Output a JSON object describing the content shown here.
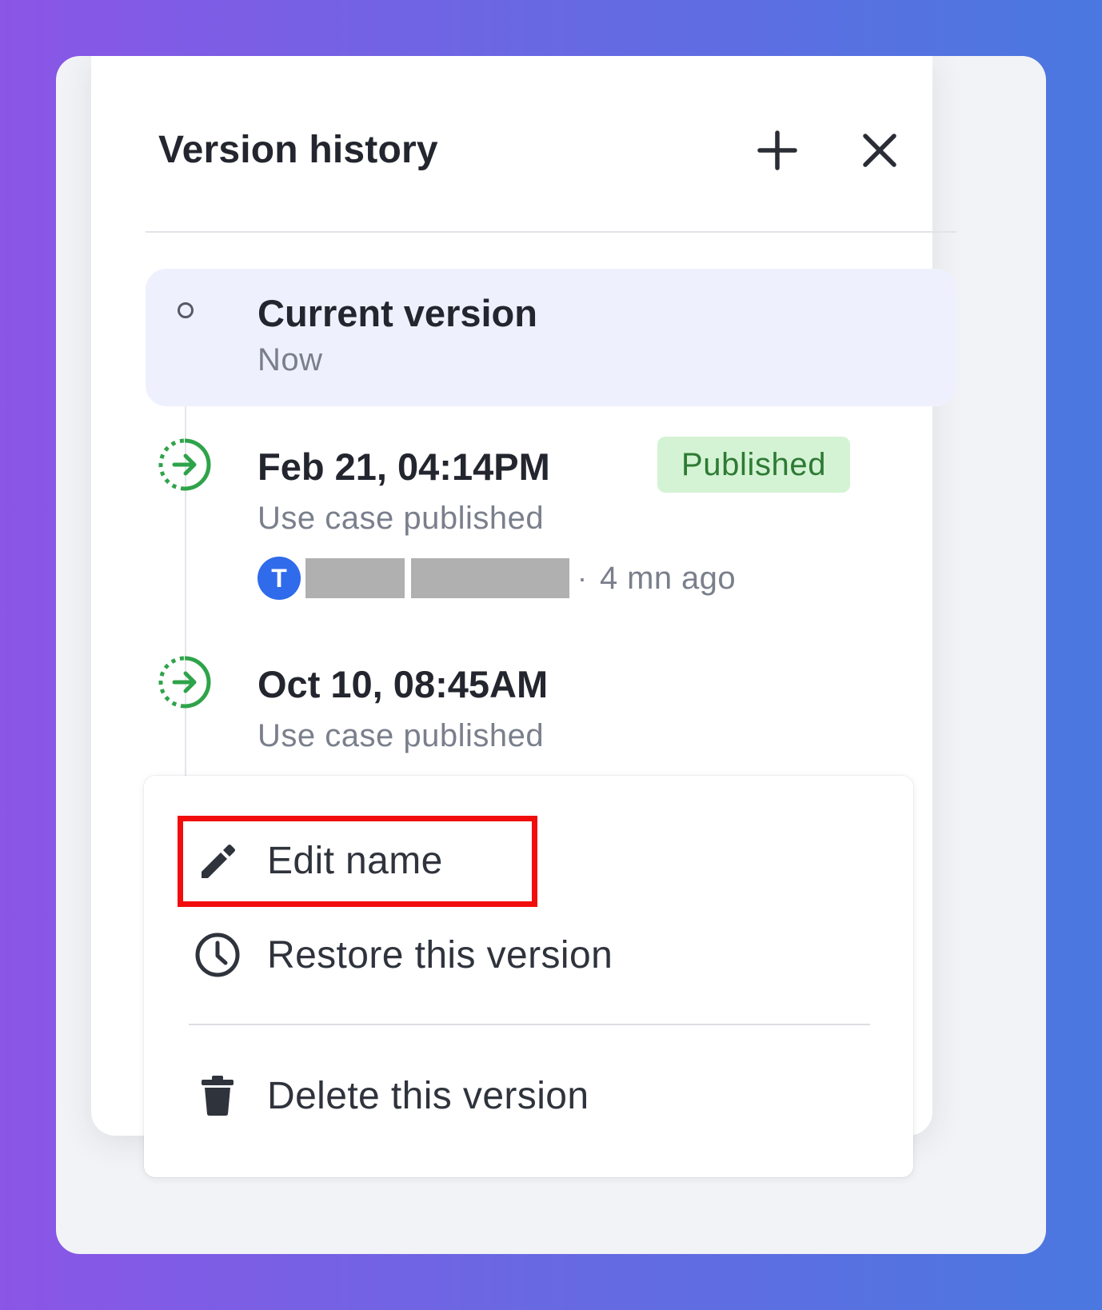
{
  "header": {
    "title": "Version history",
    "add_icon": "plus-icon",
    "close_icon": "close-icon"
  },
  "current_version": {
    "title": "Current version",
    "subtitle": "Now"
  },
  "versions": [
    {
      "title": "Feb 21, 04:14PM",
      "badge": "Published",
      "description": "Use case published",
      "avatar_initial": "T",
      "separator": "·",
      "time_ago": "4 mn ago",
      "icon": "publish-arrow-icon"
    },
    {
      "title": "Oct 10, 08:45AM",
      "description": "Use case published",
      "icon": "publish-arrow-icon"
    }
  ],
  "context_menu": {
    "items": [
      {
        "label": "Edit name",
        "icon": "pencil-icon",
        "highlighted": true
      },
      {
        "label": "Restore this version",
        "icon": "clock-icon"
      },
      {
        "label": "Delete this version",
        "icon": "trash-icon"
      }
    ]
  },
  "colors": {
    "background_start": "#8b55e6",
    "background_end": "#4a78e0",
    "current_bg": "#eef1fd",
    "badge_bg": "#d4f3d4",
    "badge_text": "#2e7a34",
    "publish_icon": "#2fa34a",
    "avatar": "#2f6bea",
    "highlight_border": "#f20d0d"
  }
}
